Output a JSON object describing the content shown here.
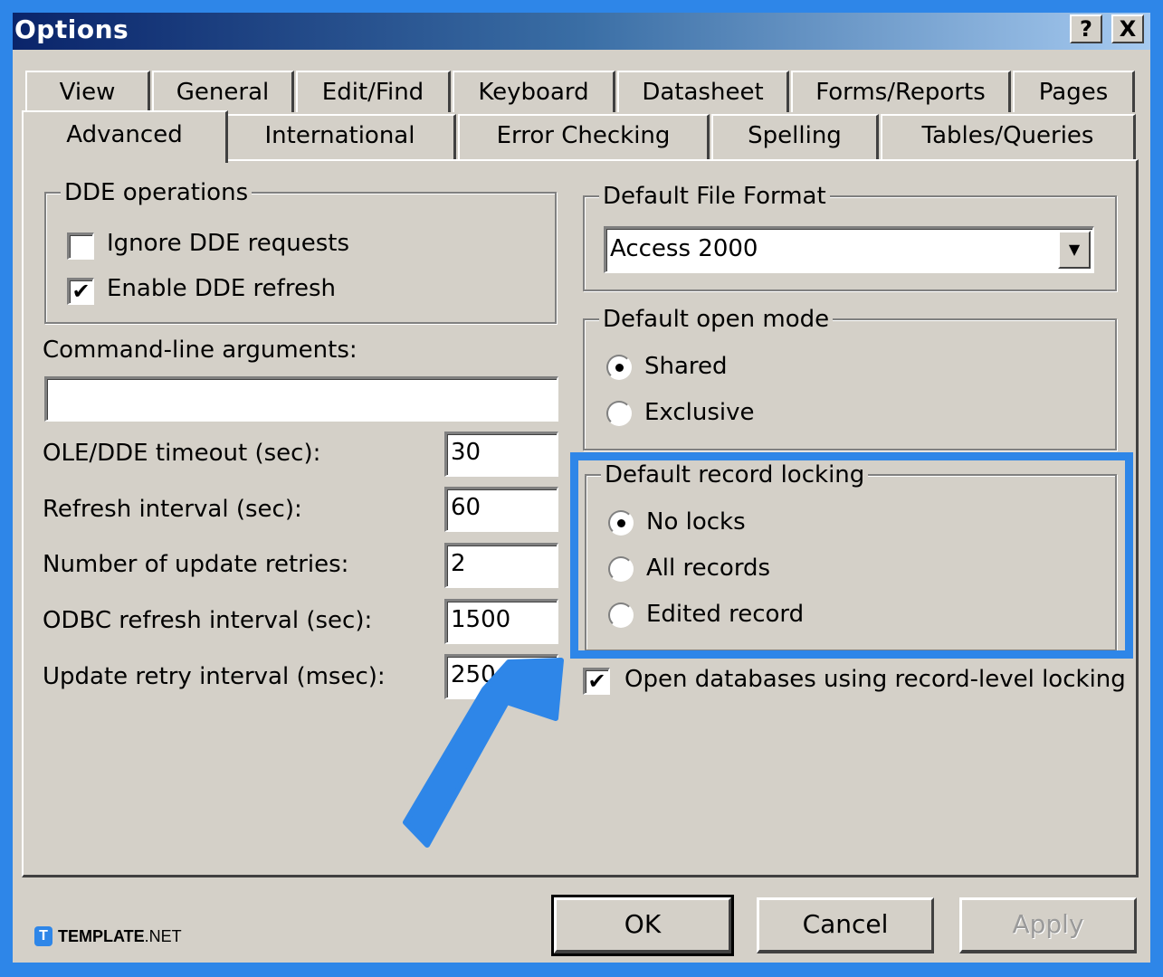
{
  "window": {
    "title": "Options",
    "help_label": "?",
    "close_label": "X"
  },
  "tabs": {
    "row1": [
      {
        "label": "View"
      },
      {
        "label": "General"
      },
      {
        "label": "Edit/Find"
      },
      {
        "label": "Keyboard"
      },
      {
        "label": "Datasheet"
      },
      {
        "label": "Forms/Reports"
      },
      {
        "label": "Pages"
      }
    ],
    "row2": [
      {
        "label": "Advanced",
        "selected": true
      },
      {
        "label": "International"
      },
      {
        "label": "Error Checking"
      },
      {
        "label": "Spelling"
      },
      {
        "label": "Tables/Queries"
      }
    ]
  },
  "dde": {
    "legend": "DDE operations",
    "ignore_label": "Ignore DDE requests",
    "ignore_checked": false,
    "enable_label": "Enable DDE refresh",
    "enable_checked": true,
    "check_glyph": "✔"
  },
  "command_line": {
    "label": "Command-line arguments:",
    "value": ""
  },
  "settings": [
    {
      "label": "OLE/DDE timeout (sec):",
      "value": "30"
    },
    {
      "label": "Refresh interval (sec):",
      "value": "60"
    },
    {
      "label": "Number of update retries:",
      "value": "2"
    },
    {
      "label": "ODBC refresh interval (sec):",
      "value": "1500"
    },
    {
      "label": "Update retry interval (msec):",
      "value": "250"
    }
  ],
  "file_format": {
    "legend": "Default File Format",
    "selected": "Access 2000",
    "arrow": "▼"
  },
  "open_mode": {
    "legend": "Default open mode",
    "options": [
      {
        "label": "Shared",
        "selected": true
      },
      {
        "label": "Exclusive",
        "selected": false
      }
    ]
  },
  "record_locking": {
    "legend": "Default record locking",
    "options": [
      {
        "label": "No locks",
        "selected": true
      },
      {
        "label": "All records",
        "selected": false
      },
      {
        "label": "Edited record",
        "selected": false
      }
    ]
  },
  "record_level": {
    "label": "Open databases using record-level locking",
    "checked": true
  },
  "buttons": {
    "ok": "OK",
    "cancel": "Cancel",
    "apply": "Apply"
  },
  "annotation": {
    "color": "#2e86e8"
  },
  "watermark": {
    "badge": "T",
    "brand_bold": "TEMPLATE",
    "brand_rest": ".NET"
  }
}
